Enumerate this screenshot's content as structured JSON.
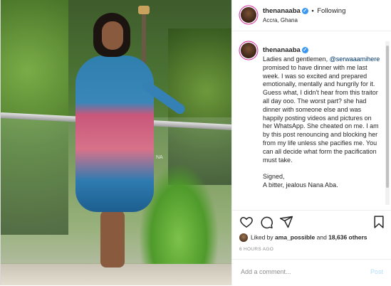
{
  "header": {
    "username": "thenanaaba",
    "follow_state": "Following",
    "separator": "•",
    "location": "Accra, Ghana"
  },
  "photo": {
    "watermark": "NA",
    "description_icon": "photo-of-woman"
  },
  "caption": {
    "username": "thenanaaba",
    "text_before_mention": "Ladies and gentlemen, ",
    "mention": "@serwaaamihere",
    "text_after_mention": " promised to have dinner with me last week. I was so excited and prepared emotionally, mentally and hungrily for it. Guess what, I didn't hear from this traitor all day ooo. The worst part? she had dinner with someone else and was happily posting videos and pictures on her WhatsApp. She cheated on me. I am by this post renouncing and blocking her from my life unless she pacifies me. You can all decide what form the pacification must take.",
    "signed_label": "Signed,",
    "signature": "A bitter, jealous Nana Aba."
  },
  "actions": {
    "like_icon": "heart-icon",
    "comment_icon": "comment-icon",
    "share_icon": "share-icon",
    "save_icon": "bookmark-icon"
  },
  "likes": {
    "prefix": "Liked by ",
    "user": "ama_possible",
    "middle": " and ",
    "others": "18,636 others"
  },
  "time_ago": "6 HOURS AGO",
  "comment_box": {
    "placeholder": "Add a comment...",
    "post_label": "Post"
  },
  "colors": {
    "verified": "#3897f0",
    "post_disabled": "#b2dffc",
    "mention": "#00376b"
  }
}
